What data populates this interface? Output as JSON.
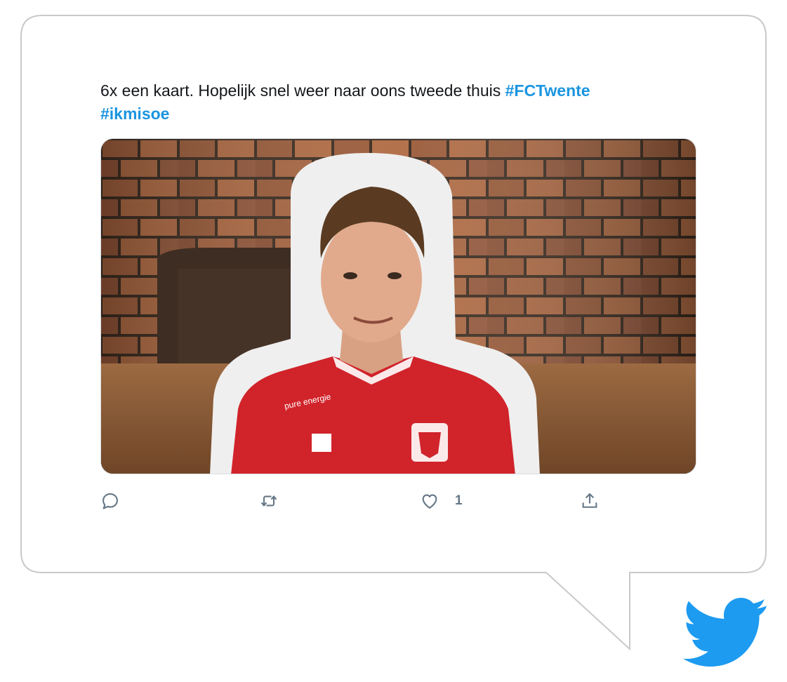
{
  "tweet": {
    "text_plain": "6x een kaart. Hopelijk snel weer naar oons tweede thuis ",
    "hashtags": [
      "#FCTwente",
      "#ikmisoe"
    ],
    "image_alt": "Cardboard cutout of FC Twente player in red shirt in front of brick wall",
    "shirt_sponsor": "pure energie"
  },
  "actions": {
    "reply_icon": "reply-icon",
    "retweet_icon": "retweet-icon",
    "like_icon": "heart-icon",
    "like_count": "1",
    "share_icon": "share-icon"
  },
  "brand": {
    "logo": "twitter-bird-icon",
    "accent": "#1d9bf0",
    "hashtag_color": "#1b95e0",
    "icon_gray": "#657786"
  }
}
